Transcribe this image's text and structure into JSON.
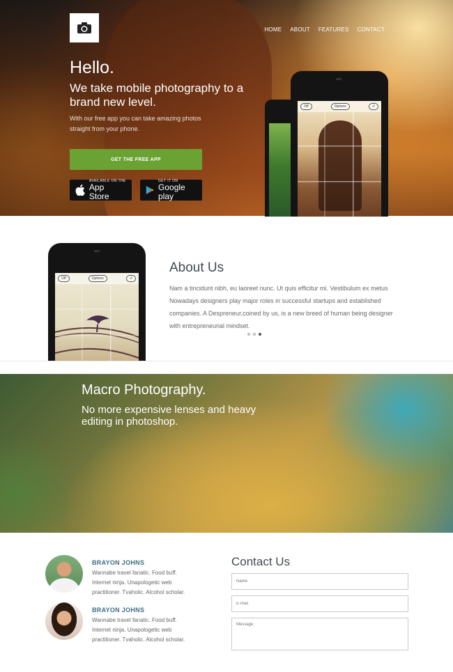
{
  "nav": {
    "items": [
      "HOME",
      "ABOUT",
      "FEATURES",
      "CONTACT"
    ]
  },
  "hero": {
    "title": "Hello.",
    "subtitle": "We take mobile photography to a brand new level.",
    "description": "With our free app you can take amazing photos straight from your phone.",
    "cta_label": "GET THE FREE APP",
    "app_store": {
      "small": "AVAILABLE ON THE",
      "big": "App Store"
    },
    "google_play": {
      "small": "GET IT ON",
      "big": "Google play"
    }
  },
  "phone_ui": {
    "flash": "Off",
    "options": "Options"
  },
  "about": {
    "title": "About Us",
    "text": "Nam a tincidunt nibh, eu laoreet nunc. Ut quis efficitur mi. Vestibulum ex metus Nowadays designers play major roles in successful startups and established companies. A Despreneur,coined by us, is a new breed of human being designer with entrepreneurial mindset."
  },
  "macro": {
    "title": "Macro Photography.",
    "subtitle": "No more expensive lenses and heavy editing in photoshop."
  },
  "team": [
    {
      "name": "BRAYON JOHNS",
      "bio": "Wannabe travel fanatic. Food buff. Internet ninja. Unapologetic web practitioner. Tvaholic. Alcohol scholar."
    },
    {
      "name": "BRAYON JOHNS",
      "bio": "Wannabe travel fanatic. Food buff. Internet ninja. Unapologetic web practitioner. Tvaholic. Alcohol scholar."
    }
  ],
  "contact": {
    "title": "Contact Us",
    "name_placeholder": "Name",
    "email_placeholder": "E-mail",
    "message_placeholder": "Message"
  },
  "colors": {
    "accent_green": "#6aa233",
    "heading_blue": "#3e6e86",
    "heading_dark": "#3e4a52"
  }
}
